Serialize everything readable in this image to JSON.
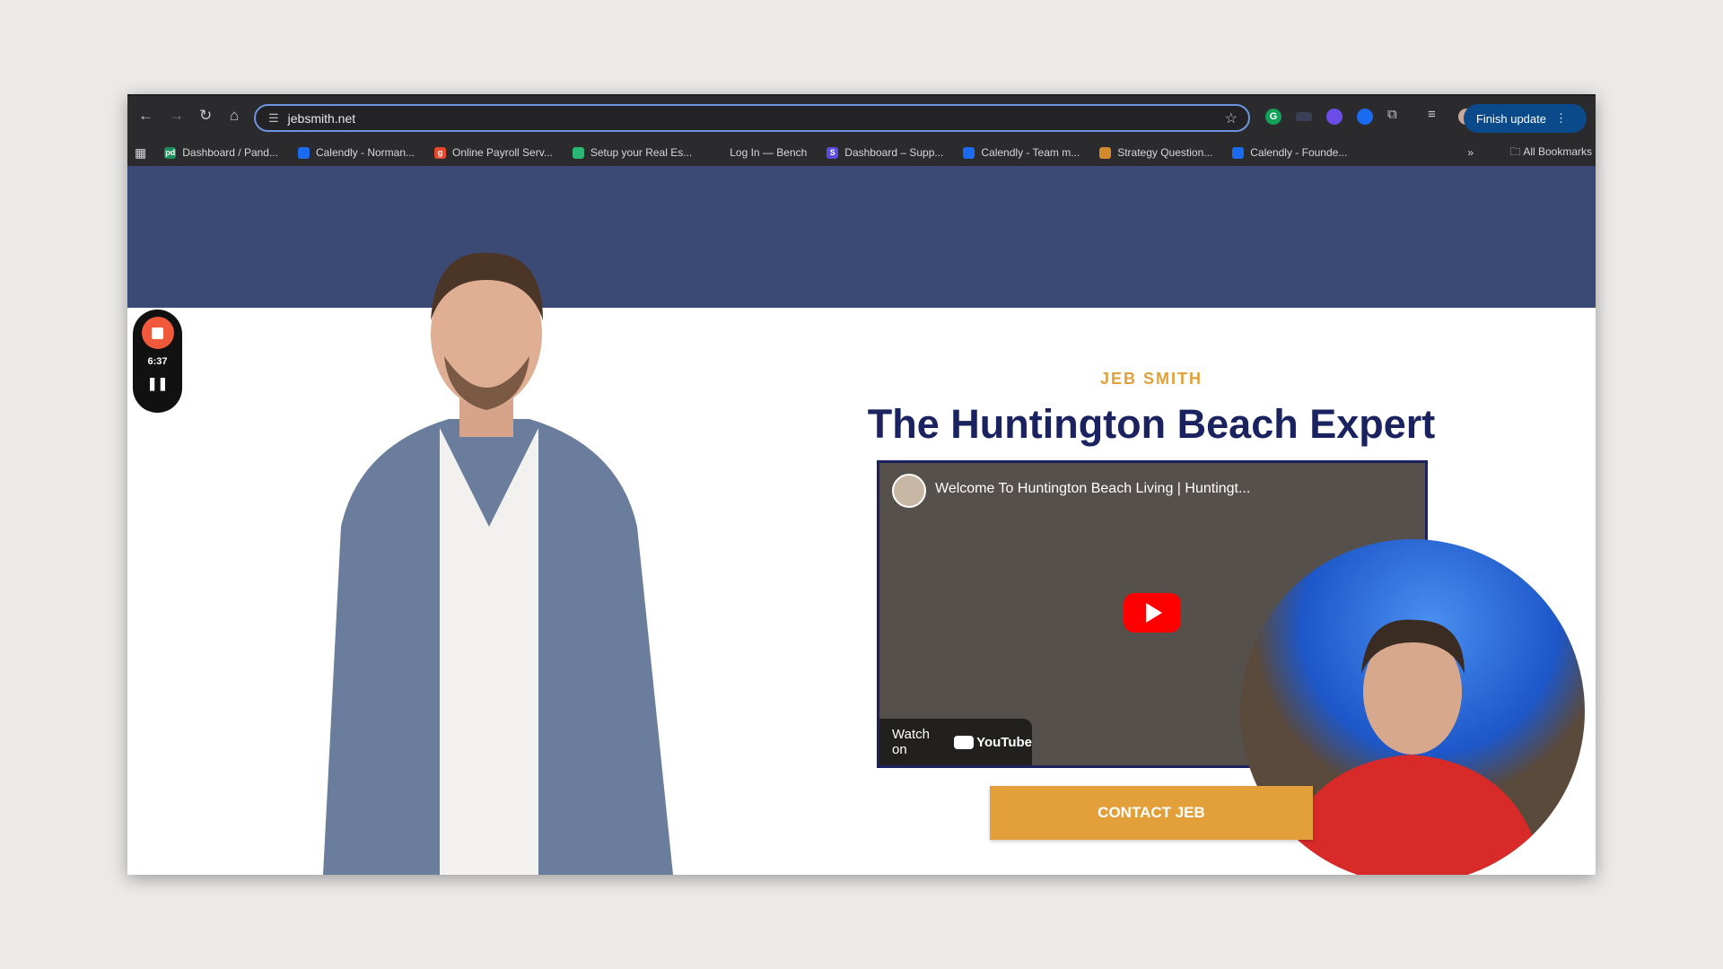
{
  "browser": {
    "url": "jebsmith.net",
    "finish_update": "Finish update",
    "bookmarks": [
      {
        "label": "Dashboard / Pand...",
        "color": "#1d8f5a",
        "glyph": "pd"
      },
      {
        "label": "Calendly - Norman...",
        "color": "#1b6bf0",
        "glyph": ""
      },
      {
        "label": "Online Payroll Serv...",
        "color": "#e8492c",
        "glyph": "g"
      },
      {
        "label": "Setup your Real Es...",
        "color": "#2bb673",
        "glyph": ""
      },
      {
        "label": "Log In — Bench",
        "color": "#2b2b2d",
        "glyph": ""
      },
      {
        "label": "Dashboard – Supp...",
        "color": "#5b4ce0",
        "glyph": "S"
      },
      {
        "label": "Calendly - Team m...",
        "color": "#1b6bf0",
        "glyph": ""
      },
      {
        "label": "Strategy Question...",
        "color": "#d38a2c",
        "glyph": ""
      },
      {
        "label": "Calendly - Founde...",
        "color": "#1b6bf0",
        "glyph": ""
      }
    ],
    "all_bookmarks": "All Bookmarks"
  },
  "recorder": {
    "time": "6:37"
  },
  "hero": {
    "eyebrow": "JEB SMITH",
    "title": "The Huntington Beach Expert",
    "video": {
      "title": "Welcome To Huntington Beach Living | Huntingt...",
      "watch_on": "Watch on",
      "platform": "YouTube"
    },
    "cta": "CONTACT JEB"
  },
  "colors": {
    "band": "#3b4a74",
    "accent": "#e3a03a",
    "heading": "#1b2260"
  }
}
